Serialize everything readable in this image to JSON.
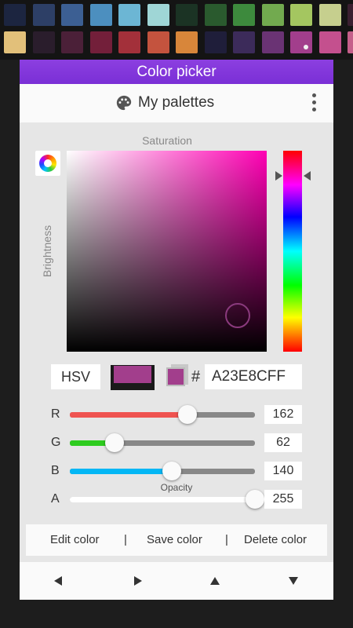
{
  "swatches": {
    "row1": [
      "#1c2540",
      "#2d3f66",
      "#3c5f93",
      "#4c8fbf",
      "#6cb6d4",
      "#9fd6d6",
      "#1b3324",
      "#2a5a2e",
      "#3d8a3d",
      "#72aa4f",
      "#a4c660",
      "#c6cf8e",
      "#3a1f30"
    ],
    "row2": [
      "#e2c07a",
      "#2a1d2c",
      "#4b2038",
      "#731f3a",
      "#a3303a",
      "#c4533e",
      "#d8863a",
      "#1f1e3a",
      "#3c2b5a",
      "#6a3374",
      "#a23e8c",
      "#c4508e",
      "#c55f8a"
    ],
    "selected_index_row2": 10
  },
  "dialog": {
    "title": "Color picker",
    "palettes_label": "My palettes"
  },
  "picker": {
    "saturation_label": "Saturation",
    "brightness_label": "Brightness",
    "mode": "HSV",
    "current_color": "#a23e8c",
    "hash": "#",
    "hex": "A23E8CFF",
    "opacity_label": "Opacity"
  },
  "channels": [
    {
      "label": "R",
      "value": "162",
      "fraction": 0.635,
      "color": "#ef5350"
    },
    {
      "label": "G",
      "value": "62",
      "fraction": 0.243,
      "color": "#2ecc1f"
    },
    {
      "label": "B",
      "value": "140",
      "fraction": 0.549,
      "color": "#03b7f5"
    },
    {
      "label": "A",
      "value": "255",
      "fraction": 1.0,
      "color": "#ffffff"
    }
  ],
  "actions": {
    "edit": "Edit color",
    "save": "Save color",
    "delete": "Delete color",
    "separator": "|"
  }
}
